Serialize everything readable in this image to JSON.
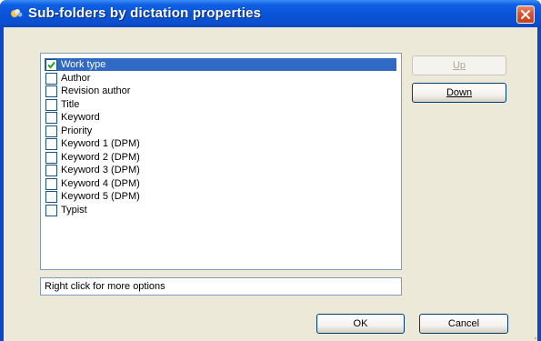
{
  "window": {
    "title": "Sub-folders by dictation properties",
    "icon": "app-icon"
  },
  "list": {
    "items": [
      {
        "label": "Work type",
        "checked": true,
        "selected": true
      },
      {
        "label": "Author",
        "checked": false,
        "selected": false
      },
      {
        "label": "Revision author",
        "checked": false,
        "selected": false
      },
      {
        "label": "Title",
        "checked": false,
        "selected": false
      },
      {
        "label": "Keyword",
        "checked": false,
        "selected": false
      },
      {
        "label": "Priority",
        "checked": false,
        "selected": false
      },
      {
        "label": "Keyword 1 (DPM)",
        "checked": false,
        "selected": false
      },
      {
        "label": "Keyword 2 (DPM)",
        "checked": false,
        "selected": false
      },
      {
        "label": "Keyword 3 (DPM)",
        "checked": false,
        "selected": false
      },
      {
        "label": "Keyword 4 (DPM)",
        "checked": false,
        "selected": false
      },
      {
        "label": "Keyword 5 (DPM)",
        "checked": false,
        "selected": false
      },
      {
        "label": "Typist",
        "checked": false,
        "selected": false
      }
    ]
  },
  "hint": "Right click for more options",
  "buttons": {
    "up": {
      "label": "Up",
      "enabled": false
    },
    "down": {
      "label": "Down",
      "enabled": true
    },
    "ok": "OK",
    "cancel": "Cancel"
  },
  "colors": {
    "titlebar": "#0a53d8",
    "selection": "#316ac5",
    "close": "#d7532f",
    "checkmark": "#21a121"
  }
}
